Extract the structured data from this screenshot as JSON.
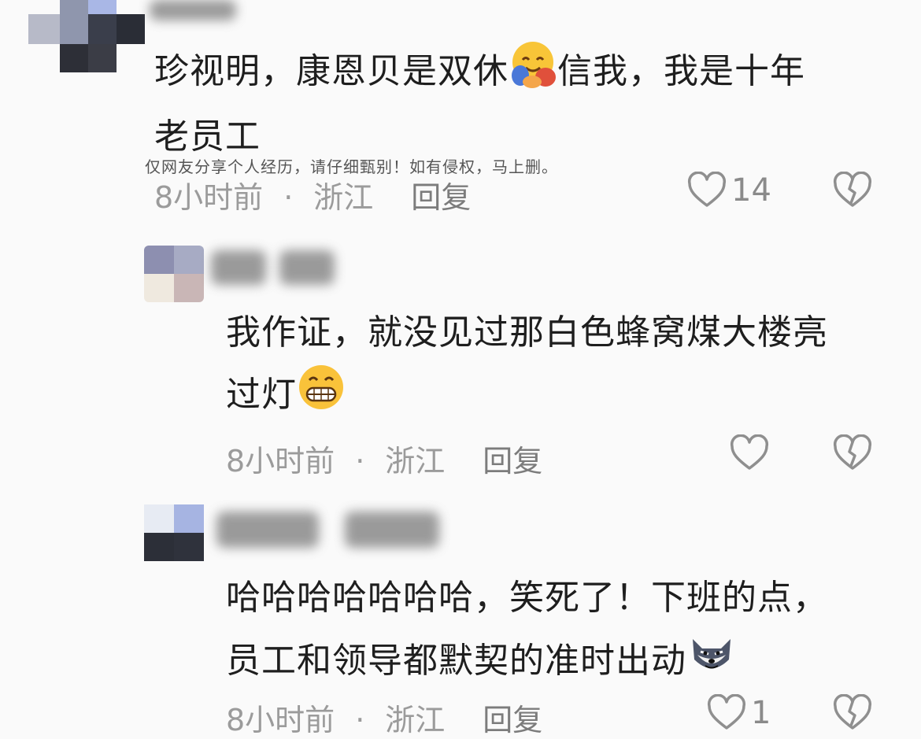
{
  "comments": [
    {
      "text_line1": "珍视明，康恩贝是双休",
      "text_after_emoji": "信我，我是十年",
      "text_line2": "老员工",
      "emoji": "hugging-face-emoji",
      "time": "8小时前",
      "separator": "·",
      "location": "浙江",
      "reply_label": "回复",
      "like_count": "14"
    },
    {
      "text_line1": "我作证，就没见过那白色蜂窝煤大楼亮",
      "text_line2": "过灯",
      "emoji": "grinning-face-emoji",
      "time": "8小时前",
      "separator": "·",
      "location": "浙江",
      "reply_label": "回复",
      "like_count": ""
    },
    {
      "text_line1": "哈哈哈哈哈哈哈，笑死了！下班的点，",
      "text_line2": "员工和领导都默契的准时出动",
      "emoji": "wolf-face-emoji",
      "time": "8小时前",
      "separator": "·",
      "location": "浙江",
      "reply_label": "回复",
      "like_count": "1"
    }
  ],
  "disclaimer": "仅网友分享个人经历，请仔细甄别！如有侵权，马上删。",
  "icons": {
    "like": "heart-outline-icon",
    "dislike": "broken-heart-icon"
  },
  "colors": {
    "background": "#fafafa",
    "text": "#1e1e1e",
    "meta": "#9b9b9b"
  }
}
